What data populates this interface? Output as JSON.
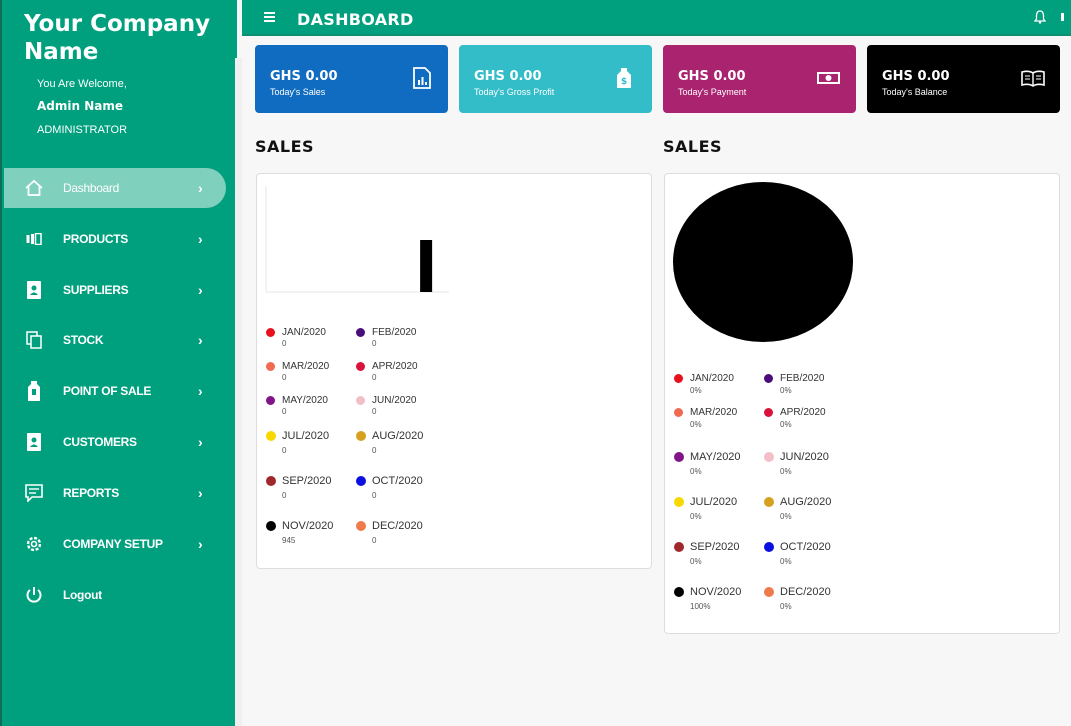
{
  "sidebar": {
    "company_name": "Your Company Name",
    "welcome": "You Are Welcome,",
    "admin_name": "Admin Name",
    "admin_role": "ADMINISTRATOR",
    "items": [
      {
        "label": "Dashboard",
        "icon": "home-icon"
      },
      {
        "label": "PRODUCTS",
        "icon": "products-icon"
      },
      {
        "label": "SUPPLIERS",
        "icon": "contacts-icon"
      },
      {
        "label": "STOCK",
        "icon": "stock-icon"
      },
      {
        "label": "POINT OF SALE",
        "icon": "pos-icon"
      },
      {
        "label": "CUSTOMERS",
        "icon": "customers-icon"
      },
      {
        "label": "REPORTS",
        "icon": "reports-icon"
      },
      {
        "label": "COMPANY SETUP",
        "icon": "gear-icon"
      },
      {
        "label": "Logout",
        "icon": "power-icon"
      }
    ],
    "chevron": "›"
  },
  "topbar": {
    "title": "DASHBOARD"
  },
  "cards": [
    {
      "amount": "GHS 0.00",
      "label": "Today's Sales",
      "color": "#0f6cc0",
      "icon": "chart-icon"
    },
    {
      "amount": "GHS 0.00",
      "label": "Today's Gross Profit",
      "color": "#33bdc9",
      "icon": "price-tag-icon"
    },
    {
      "amount": "GHS 0.00",
      "label": "Today's Payment",
      "color": "#a9236f",
      "icon": "cash-icon"
    },
    {
      "amount": "GHS 0.00",
      "label": "Today's Balance",
      "color": "#000000",
      "icon": "book-icon"
    }
  ],
  "sales_bar": {
    "title": "SALES",
    "legend": [
      {
        "label": "JAN/2020",
        "value": "0",
        "color": "#e8101c"
      },
      {
        "label": "FEB/2020",
        "value": "0",
        "color": "#4b0d7a"
      },
      {
        "label": "MAR/2020",
        "value": "0",
        "color": "#ef6a50"
      },
      {
        "label": "APR/2020",
        "value": "0",
        "color": "#d8123c"
      },
      {
        "label": "MAY/2020",
        "value": "0",
        "color": "#82148a"
      },
      {
        "label": "JUN/2020",
        "value": "0",
        "color": "#f2bfc9"
      },
      {
        "label": "JUL/2020",
        "value": "0",
        "color": "#f7d800"
      },
      {
        "label": "AUG/2020",
        "value": "0",
        "color": "#d6a11e"
      },
      {
        "label": "SEP/2020",
        "value": "0",
        "color": "#a0282c"
      },
      {
        "label": "OCT/2020",
        "value": "0",
        "color": "#0b10e0"
      },
      {
        "label": "NOV/2020",
        "value": "945",
        "color": "#000000"
      },
      {
        "label": "DEC/2020",
        "value": "0",
        "color": "#ef7a4c"
      }
    ]
  },
  "sales_pie": {
    "title": "SALES",
    "legend": [
      {
        "label": "JAN/2020",
        "value": "0%",
        "color": "#e8101c"
      },
      {
        "label": "FEB/2020",
        "value": "0%",
        "color": "#4b0d7a"
      },
      {
        "label": "MAR/2020",
        "value": "0%",
        "color": "#ef6a50"
      },
      {
        "label": "APR/2020",
        "value": "0%",
        "color": "#d8123c"
      },
      {
        "label": "MAY/2020",
        "value": "0%",
        "color": "#82148a"
      },
      {
        "label": "JUN/2020",
        "value": "0%",
        "color": "#f2bfc9"
      },
      {
        "label": "JUL/2020",
        "value": "0%",
        "color": "#f7d800"
      },
      {
        "label": "AUG/2020",
        "value": "0%",
        "color": "#d6a11e"
      },
      {
        "label": "SEP/2020",
        "value": "0%",
        "color": "#a0282c"
      },
      {
        "label": "OCT/2020",
        "value": "0%",
        "color": "#0b10e0"
      },
      {
        "label": "NOV/2020",
        "value": "100%",
        "color": "#000000"
      },
      {
        "label": "DEC/2020",
        "value": "0%",
        "color": "#ef7a4c"
      }
    ]
  },
  "chart_data": [
    {
      "type": "bar",
      "categories": [
        "JAN/2020",
        "FEB/2020",
        "MAR/2020",
        "APR/2020",
        "MAY/2020",
        "JUN/2020",
        "JUL/2020",
        "AUG/2020",
        "SEP/2020",
        "OCT/2020",
        "NOV/2020",
        "DEC/2020"
      ],
      "values": [
        0,
        0,
        0,
        0,
        0,
        0,
        0,
        0,
        0,
        0,
        945,
        0
      ],
      "title": "SALES"
    },
    {
      "type": "pie",
      "categories": [
        "JAN/2020",
        "FEB/2020",
        "MAR/2020",
        "APR/2020",
        "MAY/2020",
        "JUN/2020",
        "JUL/2020",
        "AUG/2020",
        "SEP/2020",
        "OCT/2020",
        "NOV/2020",
        "DEC/2020"
      ],
      "values": [
        0,
        0,
        0,
        0,
        0,
        0,
        0,
        0,
        0,
        0,
        100,
        0
      ],
      "title": "SALES"
    }
  ]
}
